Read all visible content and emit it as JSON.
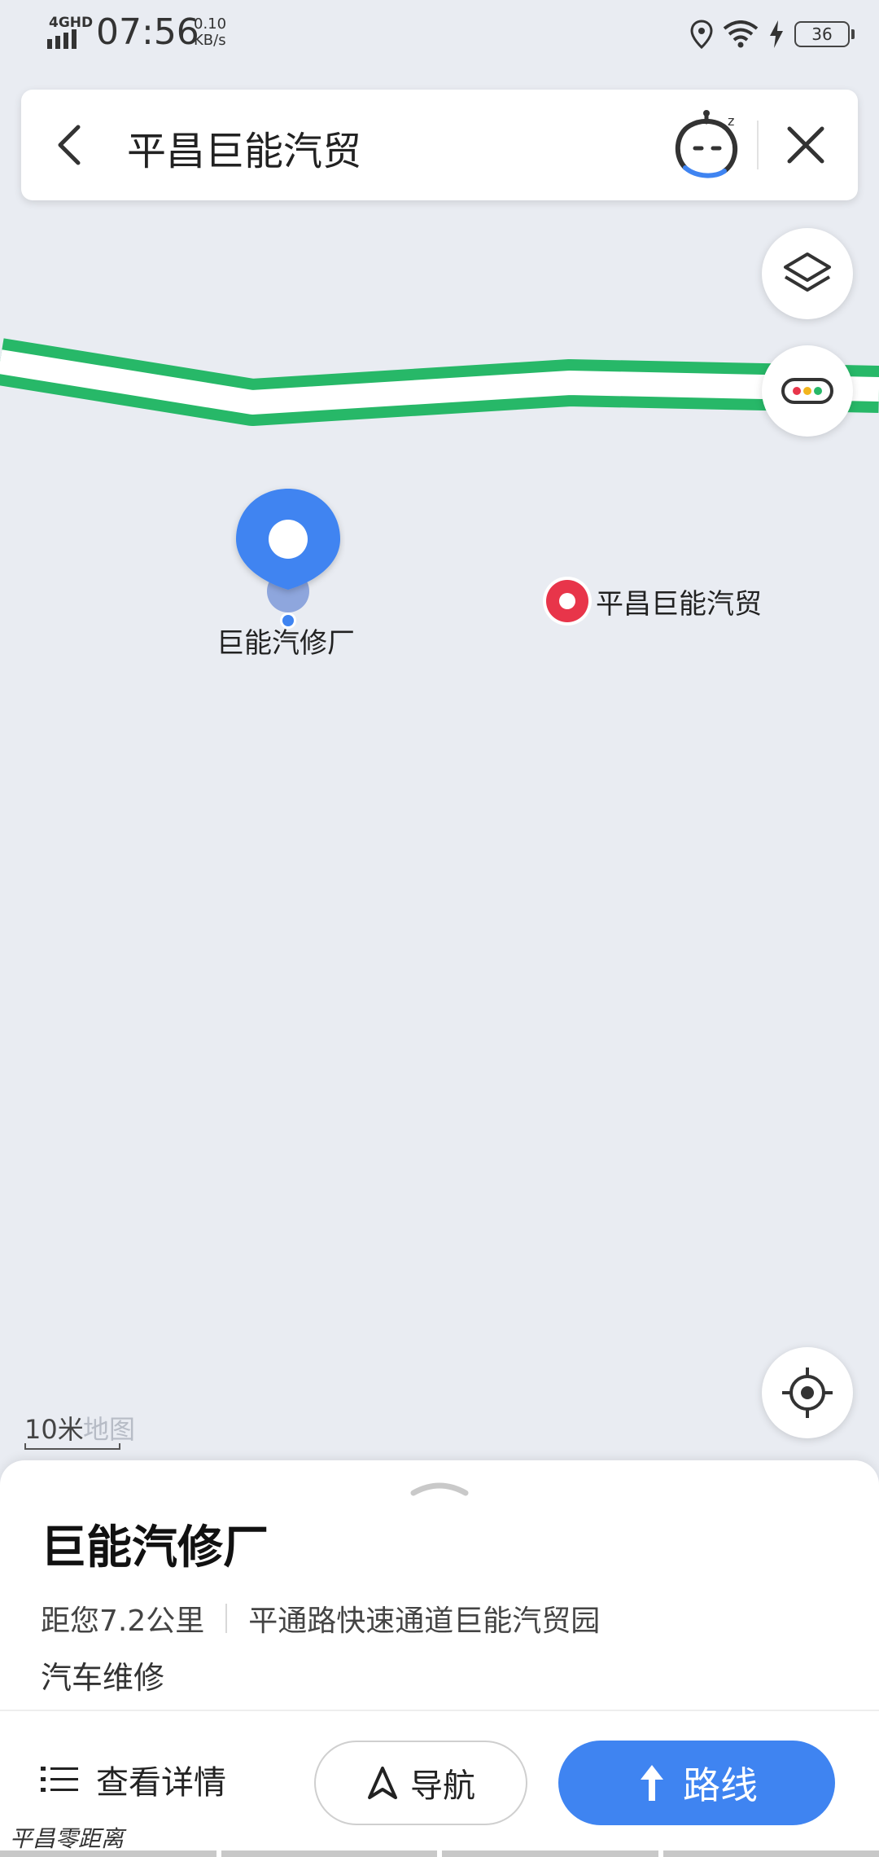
{
  "status_bar": {
    "network": "4GHD",
    "time": "07:56",
    "speed_value": "0.10",
    "speed_unit": "KB/s",
    "battery": "36"
  },
  "search": {
    "query": "平昌巨能汽贸"
  },
  "map": {
    "poi_selected_label": "巨能汽修厂",
    "poi_target_label": "平昌巨能汽贸",
    "scale_label": "10米",
    "brand_watermark": "地图",
    "colors": {
      "route": "#27b868",
      "selected_pin": "#3f84f1",
      "target_pin": "#e8354a"
    }
  },
  "sheet": {
    "title": "巨能汽修厂",
    "distance": "距您7.2公里",
    "address": "平通路快速通道巨能汽贸园",
    "category": "汽车维修",
    "details_label": "查看详情",
    "nav_label": "导航",
    "route_label": "路线"
  },
  "footer": {
    "watermark": "平昌零距离"
  }
}
